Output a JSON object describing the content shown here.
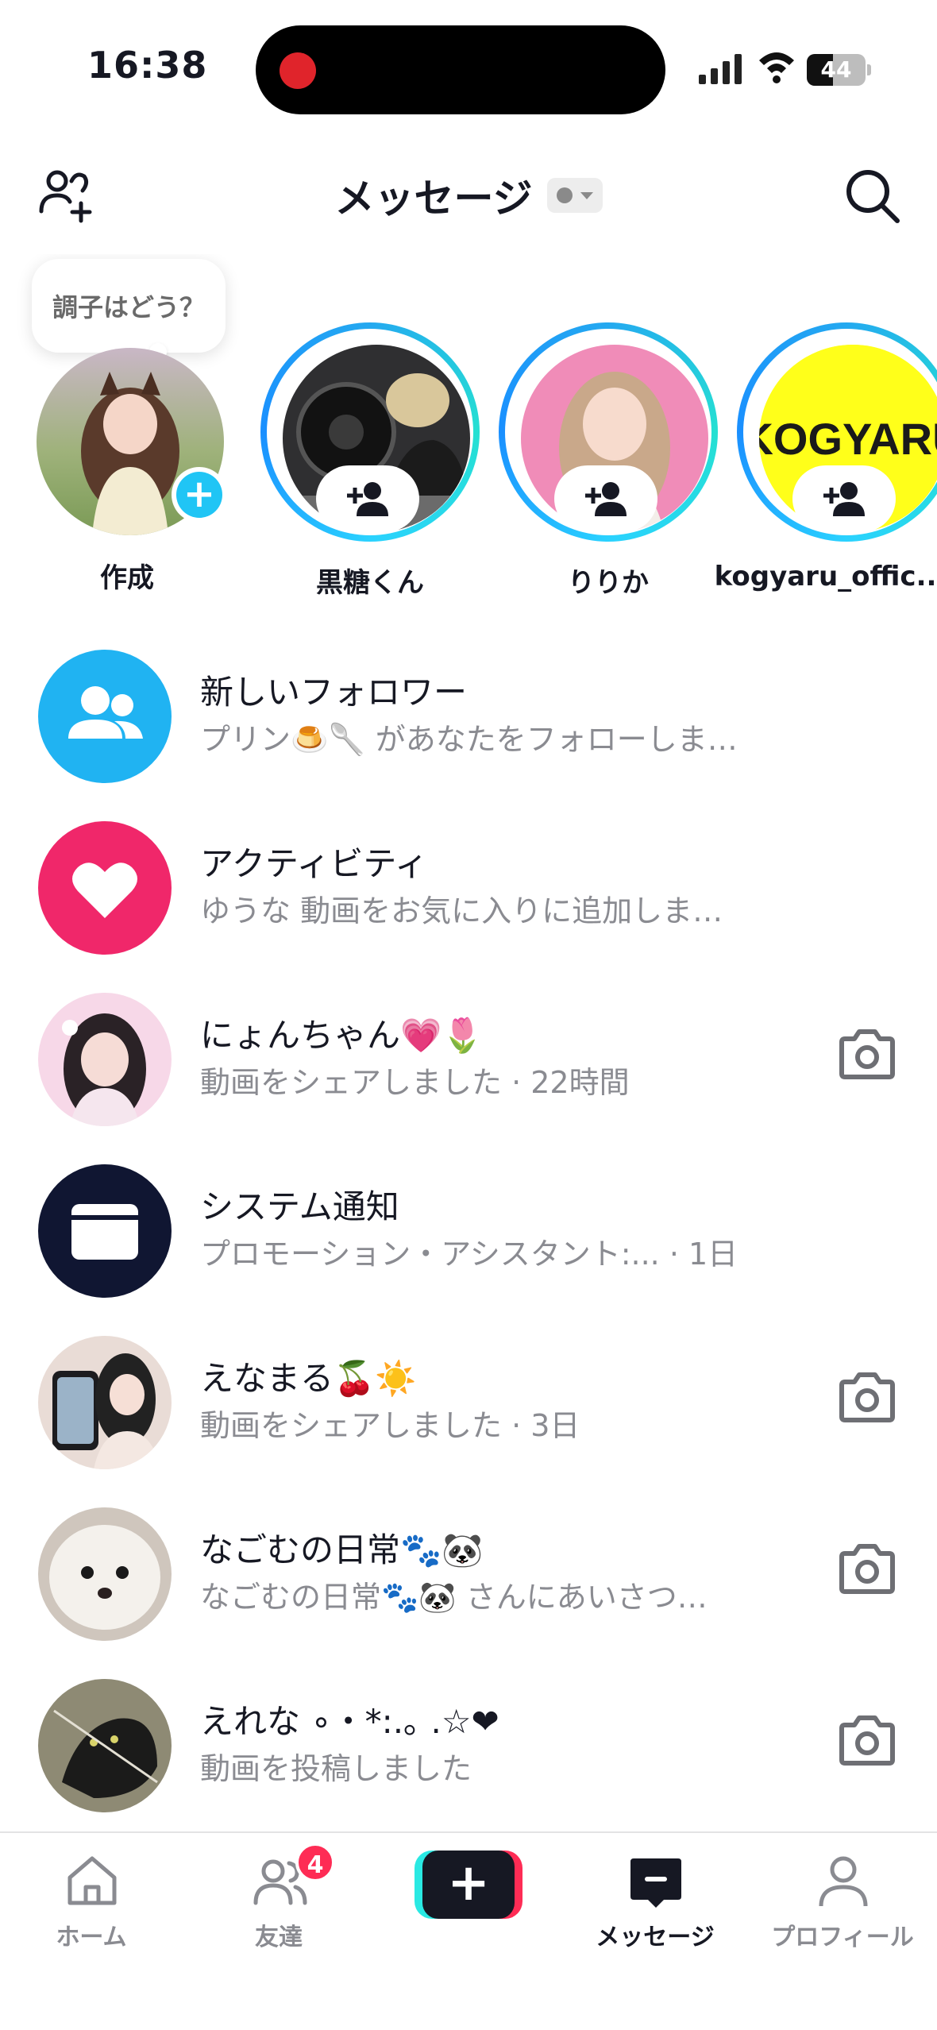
{
  "status_bar": {
    "time": "16:38",
    "battery": "44",
    "battery_level": 0.44
  },
  "header": {
    "title": "メッセージ"
  },
  "stories": {
    "bubble_text": "調子はどう？",
    "self_label": "作成",
    "items": [
      {
        "name": "黒糖くん"
      },
      {
        "name": "りりか"
      },
      {
        "name": "kogyaru_offic..."
      }
    ],
    "kogyaru_logo_text": "KOGYARU"
  },
  "messages": [
    {
      "title": "新しいフォロワー",
      "subtitle": "プリン🍮🥄 があなたをフォローしま…",
      "icon": "followers-icon",
      "color": "#20b3f2"
    },
    {
      "title": "アクティビティ",
      "subtitle": "ゆうな 動画をお気に入りに追加しま…",
      "icon": "heart-icon",
      "color": "#f0276a"
    },
    {
      "title": "にょんちゃん💗🌷",
      "subtitle": "動画をシェアしました · 22時間",
      "icon": "camera-icon"
    },
    {
      "title": "システム通知",
      "subtitle": "プロモーション・アシスタント:...  · 1日",
      "icon": "inbox-icon",
      "color": "#101632"
    },
    {
      "title": "えなまる🍒☀️",
      "subtitle": "動画をシェアしました · 3日",
      "icon": "camera-icon"
    },
    {
      "title": "なごむの日常🐾🐼",
      "subtitle": "なごむの日常🐾🐼 さんにあいさつ…",
      "icon": "camera-icon"
    },
    {
      "title": "えれな ∘・*:.｡ .☆❤",
      "subtitle": "動画を投稿しました",
      "icon": "camera-icon"
    }
  ],
  "tabbar": {
    "home": "ホーム",
    "friends": "友達",
    "friends_badge": "4",
    "create": "+",
    "messages": "メッセージ",
    "profile": "プロフィール"
  }
}
